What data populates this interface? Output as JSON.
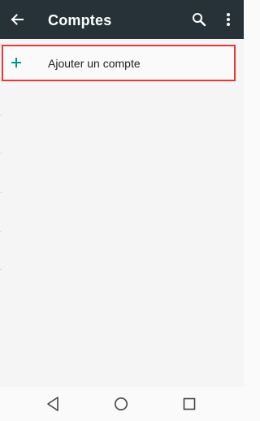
{
  "appbar": {
    "title": "Comptes",
    "back_icon": "arrow-back-icon",
    "search_icon": "search-icon",
    "more_icon": "more-vert-icon"
  },
  "list": {
    "add_account_label": "Ajouter un compte",
    "add_icon": "plus-icon"
  },
  "navbar": {
    "back_icon": "nav-back-triangle-icon",
    "home_icon": "nav-home-circle-icon",
    "recents_icon": "nav-recents-square-icon"
  },
  "colors": {
    "appbar_bg": "#263238",
    "accent": "#009688",
    "highlight_border": "#e53935",
    "background": "#f5f5f5"
  }
}
